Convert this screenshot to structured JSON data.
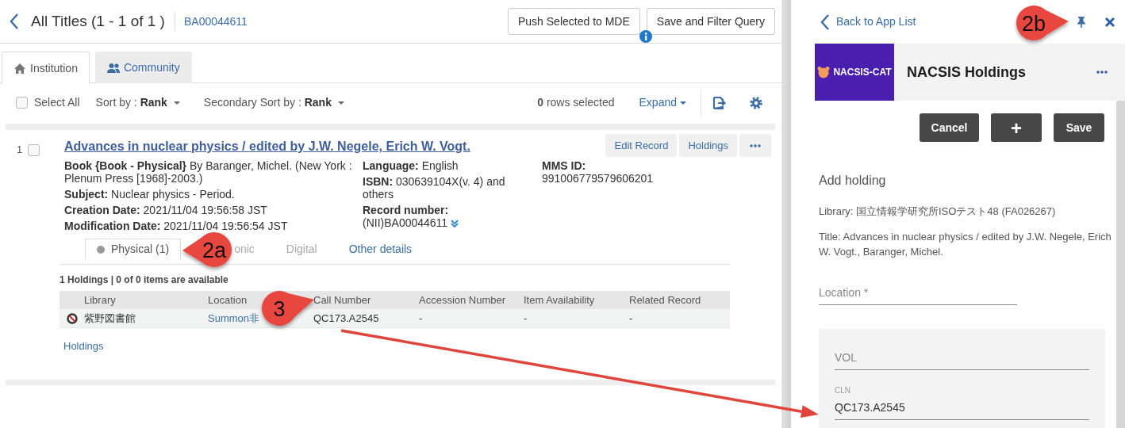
{
  "header": {
    "title": "All Titles (1 - 1 of 1 )",
    "record_id": "BA00044611",
    "buttons": [
      "Push Selected to MDE",
      "Save and Filter Query"
    ]
  },
  "scope_tabs": [
    {
      "label": "Institution",
      "selected": true
    },
    {
      "label": "Community",
      "selected": false
    }
  ],
  "toolbar": {
    "select_all": {
      "label": "Select All",
      "checked": false
    },
    "sorts": [
      {
        "label": "Sort by :",
        "value": "Rank"
      },
      {
        "label": "Secondary Sort by :",
        "value": "Rank"
      }
    ],
    "rows_selected": {
      "count": "0",
      "label": "rows selected"
    },
    "expand": "Expand"
  },
  "results": [
    {
      "number": "1",
      "checked": false,
      "title": "Advances in nuclear physics / edited by J.W. Negele, Erich W. Vogt.",
      "actions": [
        "Edit Record",
        "Holdings"
      ],
      "columns": [
        [
          {
            "text": "**Book {Book - Physical}** By Baranger, Michel. (New York : Plenum Press [1968]-2003.)",
            "expandable": false
          },
          {
            "text": "**Subject:** Nuclear physics - Period.",
            "expandable": false
          },
          {
            "text": "**Creation Date:** 2021/11/04 19:56:58 JST",
            "expandable": false
          },
          {
            "text": "**Modification Date:** 2021/11/04 19:56:54 JST",
            "expandable": false
          }
        ],
        [
          {
            "text": "**Language:** English",
            "expandable": false
          },
          {
            "text": "**ISBN:** 030639104X(v. 4) and others",
            "expandable": false
          },
          {
            "text": "**Record number:** (NII)BA00044611",
            "expandable": true
          }
        ],
        [
          {
            "text": "**MMS ID:** 991006779579606201",
            "expandable": false
          }
        ]
      ],
      "inventory_tabs": [
        {
          "label": "Physical (1)",
          "selected": true,
          "disabled": false,
          "dot": true
        },
        {
          "label": "onic",
          "selected": false,
          "disabled": true,
          "dot": false
        },
        {
          "label": "Digital",
          "selected": false,
          "disabled": true,
          "dot": false
        },
        {
          "label": "Other details",
          "selected": false,
          "disabled": false,
          "dot": false
        }
      ],
      "holdings": {
        "summary": "1 Holdings | 0 of 0 items are available",
        "columns": [
          "Library",
          "Location",
          "Call Number",
          "Accession Number",
          "Item Availability",
          "Related Record"
        ],
        "rows": [
          {
            "blocked": true,
            "cells": [
              "紫野図書館",
              "Summon非",
              "QC173.A2545",
              "-",
              "-",
              "-"
            ]
          }
        ],
        "link": "Holdings"
      }
    }
  ],
  "app_panel": {
    "back": "Back to App List",
    "logo": "NACSIS-CAT",
    "title": "NACSIS Holdings",
    "buttons": [
      "Cancel",
      "+",
      "Save"
    ],
    "heading": "Add holding",
    "library": "Library: 国立情報学研究所ISOテスト48 (FA026267)",
    "record_title": "Title: Advances in nuclear physics / edited by J.W. Negele, Erich W. Vogt., Baranger, Michel.",
    "fields": [
      {
        "placeholder": "Location *"
      }
    ],
    "group_fields": [
      {
        "placeholder": "VOL"
      },
      {
        "label": "CLN",
        "value": "QC173.A2545"
      }
    ]
  },
  "callouts": [
    "2a",
    "2b",
    "3"
  ]
}
